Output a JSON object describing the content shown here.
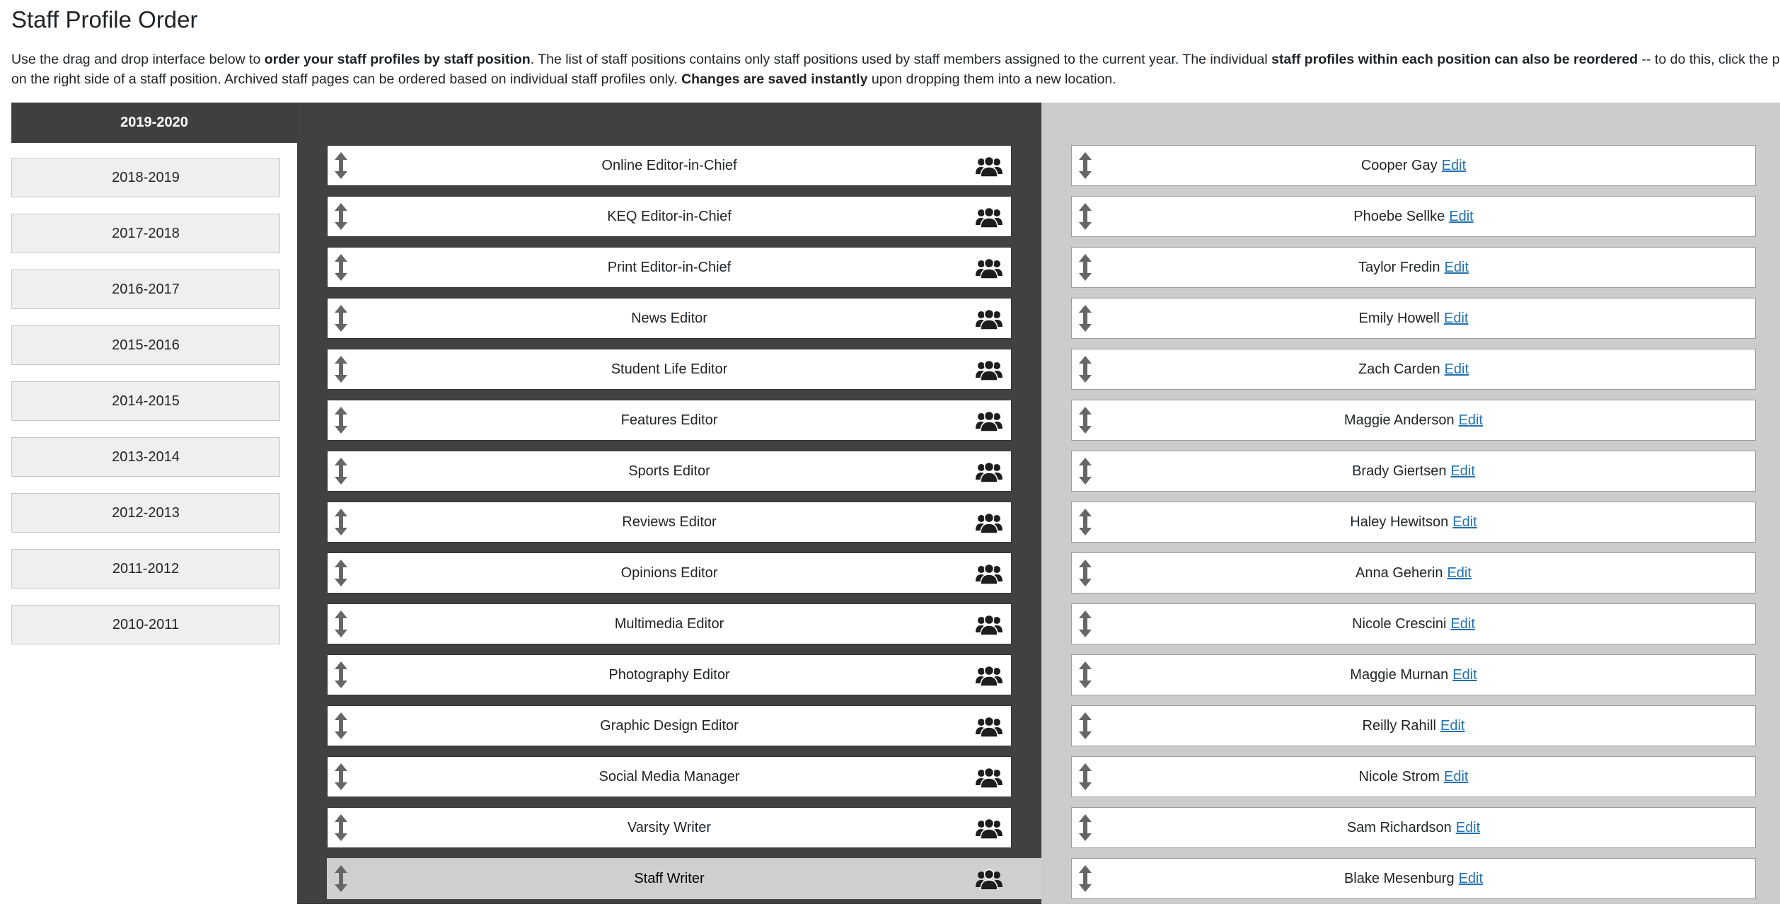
{
  "page": {
    "title": "Staff Profile Order",
    "description": {
      "part1": "Use the drag and drop interface below to ",
      "bold1": "order your staff profiles by staff position",
      "part2": ". The list of staff positions contains only staff positions used by staff members assigned to the current year. The individual ",
      "bold2": "staff profiles within each position can also be reordered",
      "part3": " -- to do this, click the profile i",
      "part4": "on the right side of a staff position. Archived staff pages can be ordered based on individual staff profiles only. ",
      "bold3": "Changes are saved instantly",
      "part5": " upon dropping them into a new location."
    }
  },
  "years": {
    "active": "2019-2020",
    "items": [
      "2018-2019",
      "2017-2018",
      "2016-2017",
      "2015-2016",
      "2014-2015",
      "2013-2014",
      "2012-2013",
      "2011-2012",
      "2010-2011"
    ]
  },
  "positions": [
    "Online Editor-in-Chief",
    "KEQ Editor-in-Chief",
    "Print Editor-in-Chief",
    "News Editor",
    "Student Life Editor",
    "Features Editor",
    "Sports Editor",
    "Reviews Editor",
    "Opinions Editor",
    "Multimedia Editor",
    "Photography Editor",
    "Graphic Design Editor",
    "Social Media Manager",
    "Varsity Writer",
    "Staff Writer"
  ],
  "dragging_position": "Staff Writer",
  "profiles": {
    "edit_label": "Edit",
    "names": [
      "Cooper Gay",
      "Phoebe Sellke",
      "Taylor Fredin",
      "Emily Howell",
      "Zach Carden",
      "Maggie Anderson",
      "Brady Giertsen",
      "Haley Hewitson",
      "Anna Geherin",
      "Nicole Crescini",
      "Maggie Murnan",
      "Reilly Rahill",
      "Nicole Strom",
      "Sam Richardson",
      "Blake Mesenburg"
    ]
  },
  "icons": {
    "row_drag": "up-down-arrow-icon",
    "group": "group-icon"
  },
  "colors": {
    "positions_panel": "#414141",
    "profiles_panel": "#cccccc",
    "active_year": "#3f3f3f",
    "link": "#2271b1"
  }
}
